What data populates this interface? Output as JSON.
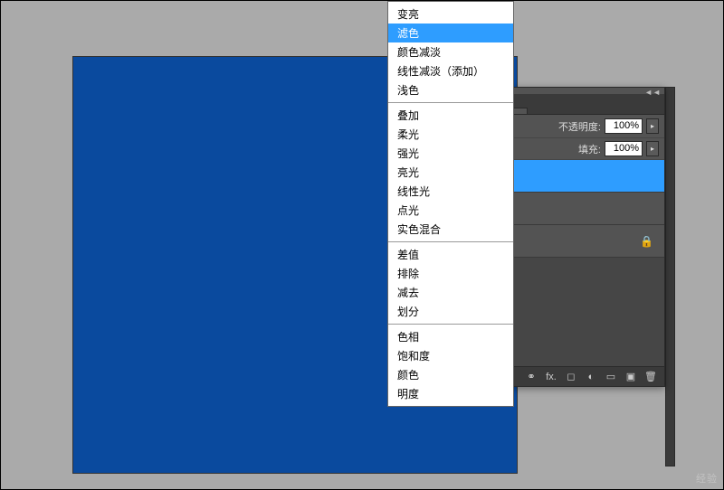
{
  "dropdown": {
    "groups": [
      {
        "items": [
          "变亮",
          {
            "label": "滤色",
            "selected": true
          },
          "颜色减淡",
          "线性减淡（添加）",
          "浅色"
        ]
      },
      {
        "items": [
          "叠加",
          "柔光",
          "强光",
          "亮光",
          "线性光",
          "点光",
          "实色混合"
        ]
      },
      {
        "items": [
          "差值",
          "排除",
          "减去",
          "划分"
        ]
      },
      {
        "items": [
          "色相",
          "饱和度",
          "颜色",
          "明度"
        ]
      }
    ]
  },
  "panel": {
    "opacity_label": "不透明度:",
    "opacity_value": "100%",
    "fill_label": "填充:",
    "fill_value": "100%",
    "lock_icon": "🔒",
    "collapse": "◄◄"
  },
  "footer": {
    "link": "⚭",
    "fx": "fx.",
    "mask": "◻",
    "adjust": "◐",
    "folder": "▭",
    "new": "▣",
    "trash": "🗑"
  },
  "watermark": "经验"
}
